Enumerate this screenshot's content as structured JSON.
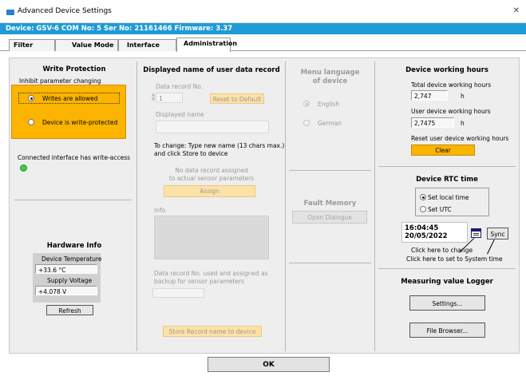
{
  "window": {
    "title": "Advanced Device Settings",
    "close": "✕"
  },
  "device_bar": "Device: GSV-6 COM No: 5 Ser No: 21161466 Firmware: 3.37",
  "tabs": [
    "Filter",
    "Value Mode",
    "Interface",
    "Administration"
  ],
  "write_protection": {
    "title": "Write Protection",
    "subtitle": "Inhibit parameter changing",
    "options": [
      "Writes are allowed",
      "Device is write-protected"
    ],
    "selected": 0,
    "status": "Connected interface has write-access",
    "accent": "#fbb400"
  },
  "hardware": {
    "title": "Hardware Info",
    "temp_label": "Device Temperature",
    "temp_value": "+33.6 °C",
    "voltage_label": "Supply Voltage",
    "voltage_value": "+4.078 V",
    "refresh": "Refresh"
  },
  "user_record": {
    "title": "Displayed name of user data record",
    "record_no_label": "Data record No.",
    "record_no_value": "1",
    "reset": "Reset to Default",
    "name_label": "Displayed name",
    "instruction_line1": "To change: Type new name (13 chars max.)",
    "instruction_line2": "and click Store to device",
    "no_assign_line1": "No data record assigned",
    "no_assign_line2": "to actual sensor parameters",
    "assign": "Assign",
    "info_label": "Info",
    "backup_line1": "Data record No. used and assigned as",
    "backup_line2": "backup for sensor parameters",
    "store": "Store Record name to device"
  },
  "language": {
    "title_line1": "Menu language",
    "title_line2": "of device",
    "options": [
      "English",
      "German"
    ],
    "selected": 0
  },
  "fault_memory": {
    "title": "Fault Memory",
    "button": "Open Dialogue"
  },
  "working_hours": {
    "title": "Device working hours",
    "total_label": "Total device working hours",
    "total_value": "2,747",
    "user_label": "User device working hours",
    "user_value": "2,7475",
    "unit": "h",
    "reset_label": "Reset user device working hours",
    "clear": "Clear"
  },
  "rtc": {
    "title": "Device RTC time",
    "options": [
      "Set local time",
      "Set UTC"
    ],
    "selected": 0,
    "time": "16:04:45",
    "date": "20/05/2022",
    "sync": "Sync",
    "hint1": "Click here to change",
    "hint2": "Click here to set to System time"
  },
  "logger": {
    "title": "Measuring value Logger",
    "settings": "Settings...",
    "browser": "File Browser..."
  },
  "ok": "OK"
}
